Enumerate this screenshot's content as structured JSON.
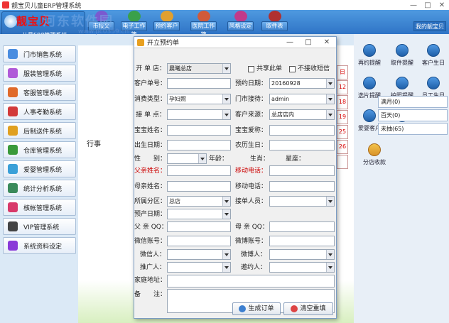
{
  "window": {
    "title": "靓宝贝儿童ERP管理系统",
    "min": "—",
    "max": "□",
    "close": "✕"
  },
  "logo": {
    "text1": "靓宝贝",
    "text2": "儿童ERP管理系统"
  },
  "watermark": {
    "text": "河东软件园",
    "url": "www.pc0359.cn"
  },
  "nav": [
    {
      "label": "市报文",
      "icon": "document-icon"
    },
    {
      "label": "电子工作簿",
      "icon": "book-icon"
    },
    {
      "label": "预约客户",
      "icon": "calendar-icon"
    },
    {
      "label": "医院工作簿",
      "icon": "hospital-icon"
    },
    {
      "label": "风格设定",
      "icon": "style-icon"
    },
    {
      "label": "取件表",
      "icon": "pickup-icon"
    }
  ],
  "my_baby": "我的靓宝贝",
  "sidebar": [
    {
      "label": "门市销售系统",
      "color": "#4a8de0"
    },
    {
      "label": "服装管理系统",
      "color": "#b05ad8"
    },
    {
      "label": "客服管理系统",
      "color": "#e06a2a"
    },
    {
      "label": "人事考勤系统",
      "color": "#d23a3a"
    },
    {
      "label": "后制送件系统",
      "color": "#e0a020"
    },
    {
      "label": "仓库管理系统",
      "color": "#3a9a3a"
    },
    {
      "label": "爱婴管理系统",
      "color": "#3aa0d8"
    },
    {
      "label": "统计分析系统",
      "color": "#3a8a5a"
    },
    {
      "label": "核帐管理系统",
      "color": "#d83a6a"
    },
    {
      "label": "VIP管理系统",
      "color": "#444444"
    },
    {
      "label": "系统资料设定",
      "color": "#8a3ad8"
    }
  ],
  "center": {
    "label": "行事"
  },
  "calendar_strip": [
    "日",
    "12",
    "18",
    "19",
    "25",
    "26",
    ""
  ],
  "right_tiles": [
    {
      "label": "再约提醒"
    },
    {
      "label": "取件提醒"
    },
    {
      "label": "客户生日"
    },
    {
      "label": "选片提醒"
    },
    {
      "label": "拍照提醒"
    },
    {
      "label": "员工生日"
    },
    {
      "label": "爱婴客户"
    },
    {
      "label": "看板提醒"
    }
  ],
  "right_list": [
    "满月(0)",
    "百天(0)",
    "未抽(65)"
  ],
  "store_receive": "分店收款",
  "dialog": {
    "title": "开立预约单",
    "fields": {
      "store": {
        "label": "开 单 店：",
        "value": "晨曦总店"
      },
      "share": {
        "label": "共享此单"
      },
      "nosms": {
        "label": "不接收短信"
      },
      "customer_no": {
        "label": "客户单号：",
        "value": ""
      },
      "appt_date": {
        "label": "预约日期：",
        "value": "20160928"
      },
      "consume_type": {
        "label": "消费类型：",
        "value": "孕妇照"
      },
      "reception": {
        "label": "门市接待：",
        "value": "admin"
      },
      "receiver_point": {
        "label": "接 单 点：",
        "value": ""
      },
      "source": {
        "label": "客户来源：",
        "value": "总店店内"
      },
      "baby_name": {
        "label": "宝宝姓名：",
        "value": ""
      },
      "baby_nick": {
        "label": "宝宝爱称：",
        "value": ""
      },
      "birth_date": {
        "label": "出生日期：",
        "value": ""
      },
      "lunar_birth": {
        "label": "农历生日：",
        "value": ""
      },
      "gender": {
        "label": "性　　别：",
        "value": ""
      },
      "age": {
        "label": "年龄：",
        "value": ""
      },
      "zodiac": {
        "label": "生肖：",
        "value": ""
      },
      "star": {
        "label": "星座：",
        "value": ""
      },
      "father_name": {
        "label": "父亲姓名：",
        "value": ""
      },
      "mobile": {
        "label": "移动电话：",
        "value": ""
      },
      "mother_name": {
        "label": "母亲姓名：",
        "value": ""
      },
      "mobile2": {
        "label": "移动电话：",
        "value": ""
      },
      "district": {
        "label": "所属分区：",
        "value": "总店"
      },
      "receiver_staff": {
        "label": "接单人员：",
        "value": ""
      },
      "due_date": {
        "label": "预产日期：",
        "value": ""
      },
      "father_qq": {
        "label": "父 亲 QQ：",
        "value": ""
      },
      "mother_qq": {
        "label": "母 亲 QQ：",
        "value": ""
      },
      "wechat_acc": {
        "label": "微信账号：",
        "value": ""
      },
      "weibo_acc": {
        "label": "微博账号：",
        "value": ""
      },
      "wechat_person": {
        "label": "微信人：",
        "value": ""
      },
      "weibo_person": {
        "label": "微博人：",
        "value": ""
      },
      "promoter": {
        "label": "推广人：",
        "value": ""
      },
      "inviter": {
        "label": "邀约人：",
        "value": ""
      },
      "address": {
        "label": "家庭地址：",
        "value": ""
      },
      "remark": {
        "label": "备　　注：",
        "value": ""
      }
    },
    "buttons": {
      "create": "生成订单",
      "reset": "清空重填"
    }
  }
}
